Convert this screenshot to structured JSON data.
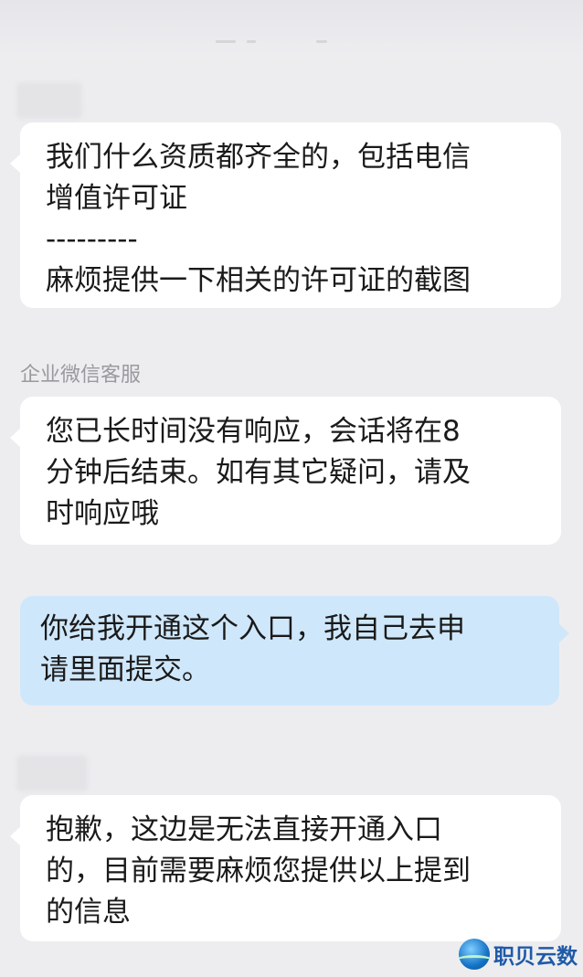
{
  "messages": [
    {
      "id": "m1",
      "direction": "incoming",
      "sender": "",
      "lines": [
        "我们什么资质都齐全的，包括电信",
        "增值许可证",
        "---------",
        "麻烦提供一下相关的许可证的截图"
      ]
    },
    {
      "id": "m2",
      "direction": "incoming",
      "sender": "企业微信客服",
      "lines": [
        "您已长时间没有响应，会话将在8",
        "分钟后结束。如有其它疑问，请及",
        "时响应哦"
      ]
    },
    {
      "id": "m3",
      "direction": "outgoing",
      "lines": [
        "你给我开通这个入口，我自己去申",
        "请里面提交。"
      ]
    },
    {
      "id": "m4",
      "direction": "incoming",
      "sender": "",
      "lines": [
        "抱歉，这边是无法直接开通入口",
        "的，目前需要麻烦您提供以上提到",
        "的信息"
      ]
    }
  ],
  "watermark": {
    "text": "职贝云数",
    "icon": "globe-logo-icon"
  },
  "colors": {
    "background": "#ededf0",
    "incoming_bubble": "#ffffff",
    "outgoing_bubble": "#cfe7fb",
    "sender_text": "#9a9a9e",
    "watermark_text": "#1f5aa8"
  }
}
